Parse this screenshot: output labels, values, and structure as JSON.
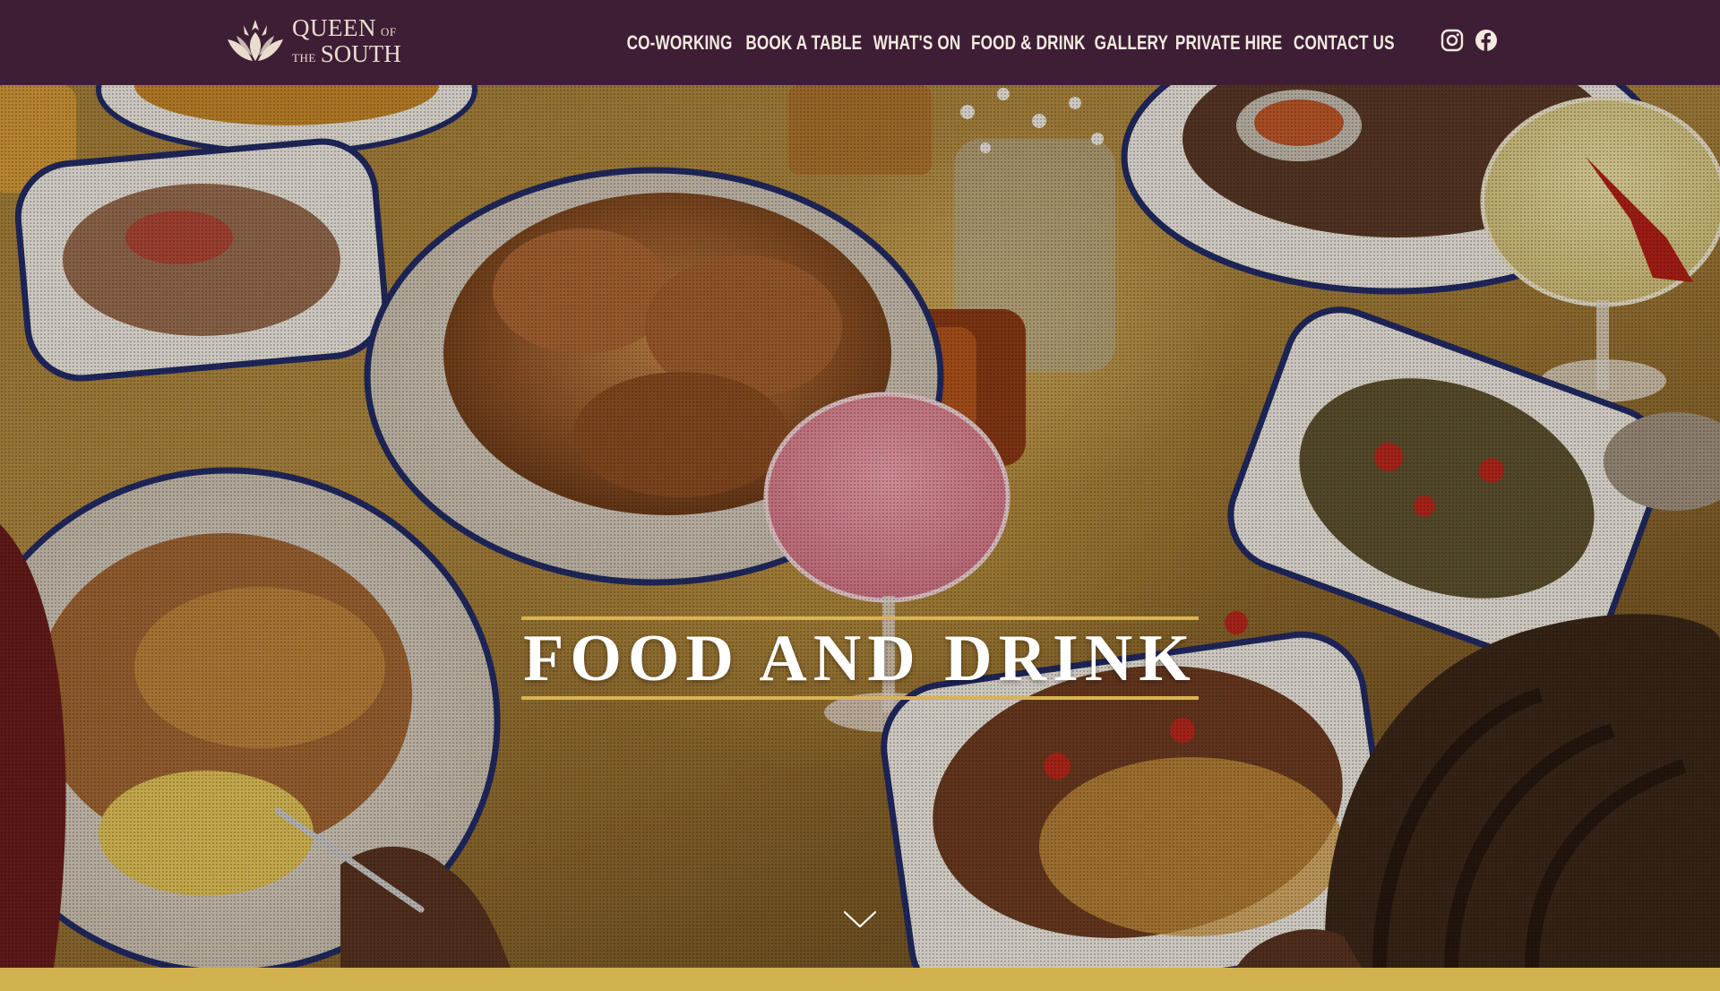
{
  "site": {
    "logo": {
      "line1_big": "QUEEN",
      "line1_small": "OF",
      "line2_small": "THE",
      "line2_big": "SOUTH",
      "icon": "lotus-crown-logo"
    }
  },
  "nav": {
    "items": [
      {
        "label": "CO-WORKING"
      },
      {
        "label": "BOOK A TABLE"
      },
      {
        "label": "WHAT'S ON"
      },
      {
        "label": "FOOD & DRINK"
      },
      {
        "label": "GALLERY"
      },
      {
        "label": "PRIVATE HIRE"
      },
      {
        "label": "CONTACT US"
      }
    ]
  },
  "social": [
    {
      "icon": "instagram-icon"
    },
    {
      "icon": "facebook-icon"
    }
  ],
  "hero": {
    "title": "FOOD AND DRINK",
    "scroll_icon": "chevron-down-icon"
  },
  "colors": {
    "header_bg": "#3e1e35",
    "nav_text": "#f2eadf",
    "accent_gold": "#d8b454",
    "band_gold": "#d2b24e",
    "hero_title": "#ffffff"
  }
}
